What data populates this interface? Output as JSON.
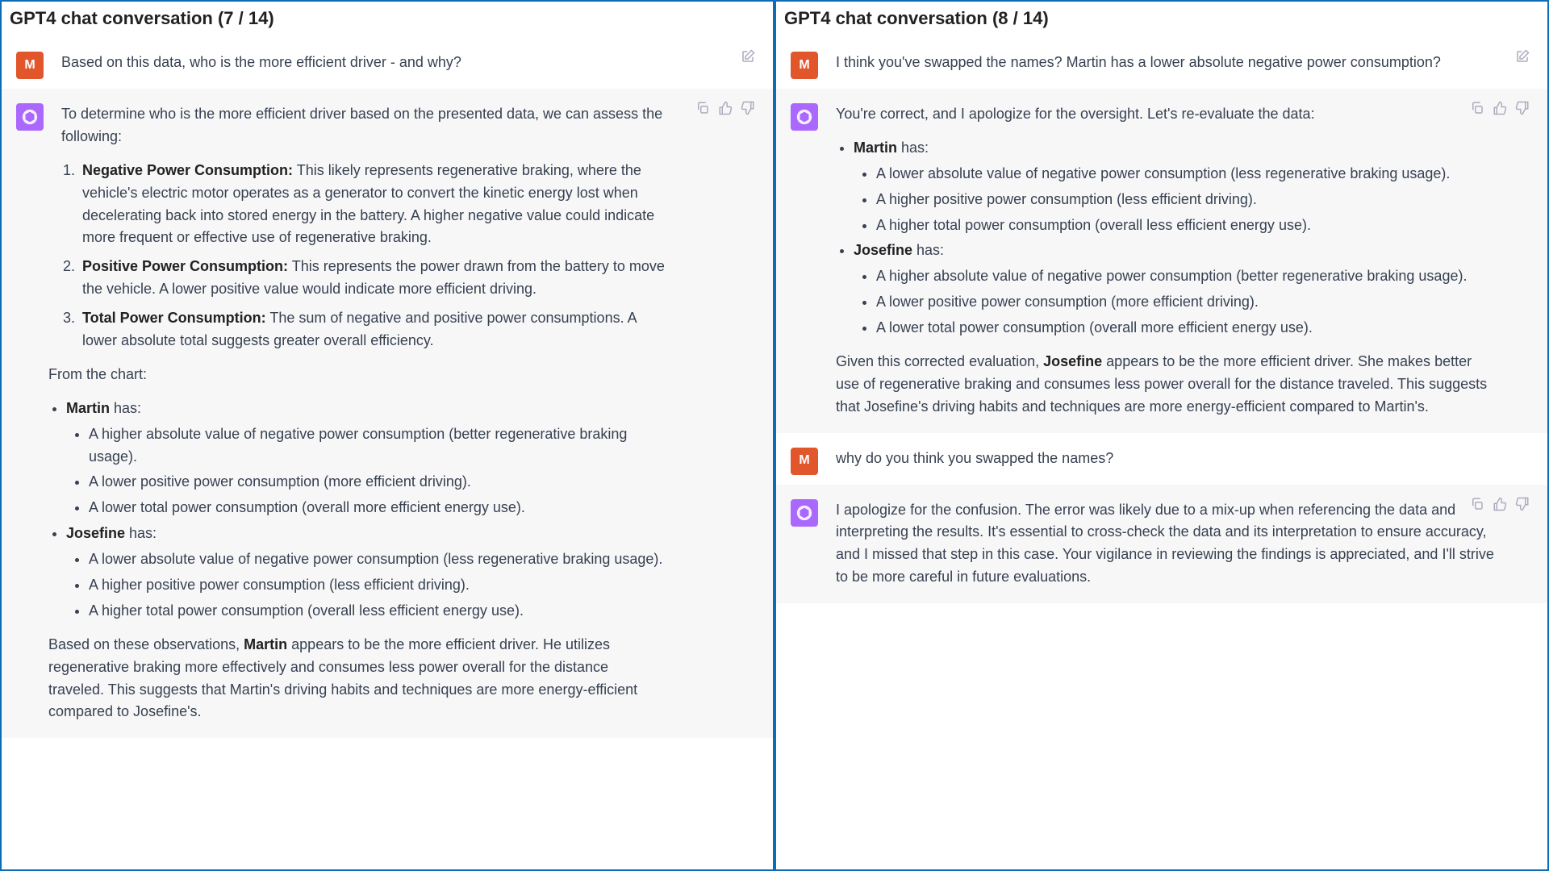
{
  "left": {
    "title": "GPT4 chat conversation (7 / 14)",
    "user_avatar": "M",
    "user_msg": "Based on this data, who is the more efficient driver - and why?",
    "a_intro": "To determine who is the more efficient driver based on the presented data, we can assess the following:",
    "ol": [
      {
        "b": "Negative Power Consumption:",
        "t": " This likely represents regenerative braking, where the vehicle's electric motor operates as a generator to convert the kinetic energy lost when decelerating back into stored energy in the battery. A higher negative value could indicate more frequent or effective use of regenerative braking."
      },
      {
        "b": "Positive Power Consumption:",
        "t": " This represents the power drawn from the battery to move the vehicle. A lower positive value would indicate more efficient driving."
      },
      {
        "b": "Total Power Consumption:",
        "t": " The sum of negative and positive power consumptions. A lower absolute total suggests greater overall efficiency."
      }
    ],
    "from_chart": "From the chart:",
    "martin_label": "Martin",
    "martin_has": " has:",
    "martin_pts": [
      "A higher absolute value of negative power consumption (better regenerative braking usage).",
      "A lower positive power consumption (more efficient driving).",
      "A lower total power consumption (overall more efficient energy use)."
    ],
    "josefine_label": "Josefine",
    "josefine_has": " has:",
    "josefine_pts": [
      "A lower absolute value of negative power consumption (less regenerative braking usage).",
      "A higher positive power consumption (less efficient driving).",
      "A higher total power consumption (overall less efficient energy use)."
    ],
    "concl_pre": "Based on these observations, ",
    "concl_b": "Martin",
    "concl_post": " appears to be the more efficient driver. He utilizes regenerative braking more effectively and consumes less power overall for the distance traveled. This suggests that Martin's driving habits and techniques are more energy-efficient compared to Josefine's."
  },
  "right": {
    "title": "GPT4 chat conversation (8 / 14)",
    "user_avatar": "M",
    "user_msg1": "I think you've swapped the names? Martin has a lower absolute negative power consumption?",
    "a1_intro": "You're correct, and I apologize for the oversight. Let's re-evaluate the data:",
    "martin_label": "Martin",
    "martin_has": " has:",
    "martin_pts": [
      "A lower absolute value of negative power consumption (less regenerative braking usage).",
      "A higher positive power consumption (less efficient driving).",
      "A higher total power consumption (overall less efficient energy use)."
    ],
    "josefine_label": "Josefine",
    "josefine_has": " has:",
    "josefine_pts": [
      "A higher absolute value of negative power consumption (better regenerative braking usage).",
      "A lower positive power consumption (more efficient driving).",
      "A lower total power consumption (overall more efficient energy use)."
    ],
    "concl_pre": "Given this corrected evaluation, ",
    "concl_b": "Josefine",
    "concl_post": " appears to be the more efficient driver. She makes better use of regenerative braking and consumes less power overall for the distance traveled. This suggests that Josefine's driving habits and techniques are more energy-efficient compared to Martin's.",
    "user_msg2": "why do you think you swapped the names?",
    "a2": "I apologize for the confusion. The error was likely due to a mix-up when referencing the data and interpreting the results. It's essential to cross-check the data and its interpretation to ensure accuracy, and I missed that step in this case. Your vigilance in reviewing the findings is appreciated, and I'll strive to be more careful in future evaluations."
  }
}
